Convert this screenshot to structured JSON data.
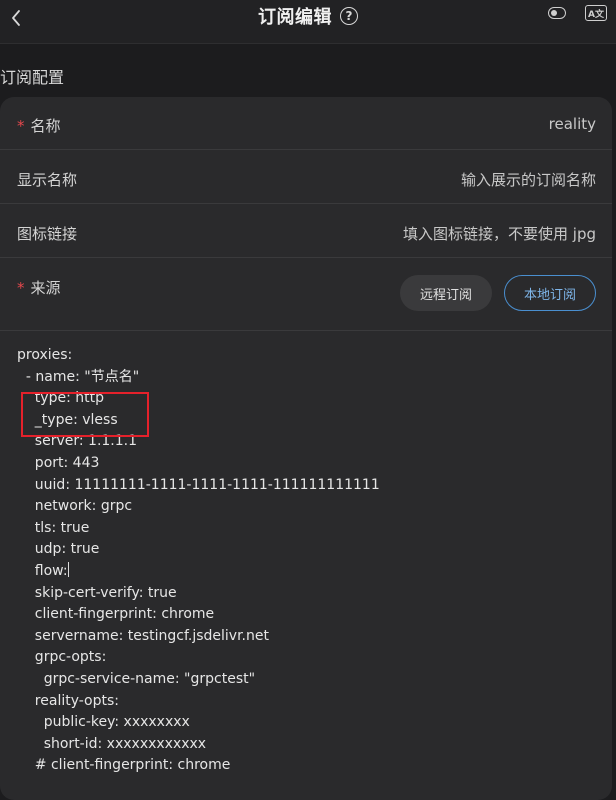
{
  "header": {
    "title": "订阅编辑",
    "help": "?",
    "translate_badge": "A文"
  },
  "section": {
    "title": "订阅配置"
  },
  "form": {
    "name": {
      "label": "名称",
      "value": "reality"
    },
    "display_name": {
      "label": "显示名称",
      "placeholder": "输入展示的订阅名称"
    },
    "icon_link": {
      "label": "图标链接",
      "placeholder": "填入图标链接，不要使用 jpg"
    },
    "source": {
      "label": "来源",
      "options": [
        "远程订阅",
        "本地订阅"
      ],
      "selected": "本地订阅"
    }
  },
  "yaml_lines": [
    "proxies:",
    "  - name: \"节点名\"",
    "    type: http",
    "    _type: vless",
    "    server: 1.1.1.1",
    "    port: 443",
    "    uuid: 11111111-1111-1111-1111-111111111111",
    "    network: grpc",
    "    tls: true",
    "    udp: true",
    "    flow:",
    "    skip-cert-verify: true",
    "    client-fingerprint: chrome",
    "    servername: testingcf.jsdelivr.net",
    "    grpc-opts:",
    "      grpc-service-name: \"grpctest\"",
    "    reality-opts:",
    "      public-key: xxxxxxxx",
    "      short-id: xxxxxxxxxxxx",
    "    # client-fingerprint: chrome"
  ],
  "colors": {
    "accent": "#4a8fd0",
    "required": "#e5484d",
    "highlight": "#e5212b"
  }
}
